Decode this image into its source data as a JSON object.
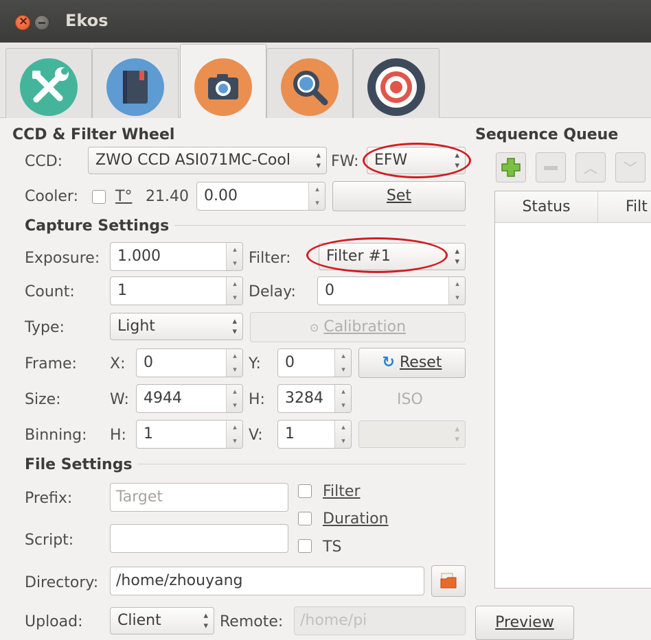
{
  "window": {
    "title": "Ekos"
  },
  "tabs": [
    {
      "name": "setup",
      "icon": "wrench-screwdriver-icon"
    },
    {
      "name": "scheduler",
      "icon": "notebook-icon"
    },
    {
      "name": "capture",
      "icon": "camera-icon",
      "active": true
    },
    {
      "name": "focus",
      "icon": "magnifier-icon"
    },
    {
      "name": "align",
      "icon": "target-icon"
    }
  ],
  "ccd_section": {
    "title": "CCD & Filter Wheel",
    "ccd_label": "CCD:",
    "ccd_value": "ZWO CCD ASI071MC-Cool",
    "fw_label": "FW:",
    "fw_value": "EFW",
    "cooler_label": "Cooler:",
    "temp_symbol": "T°",
    "temp_value": "21.40",
    "temp_setpoint": "0.00",
    "set_button": "Set"
  },
  "capture_section": {
    "title": "Capture Settings",
    "exposure_label": "Exposure:",
    "exposure_value": "1.000",
    "filter_label": "Filter:",
    "filter_value": "Filter #1",
    "count_label": "Count:",
    "count_value": "1",
    "delay_label": "Delay:",
    "delay_value": "0",
    "type_label": "Type:",
    "type_value": "Light",
    "calibration_button": "Calibration",
    "frame_label": "Frame:",
    "x_label": "X:",
    "x_value": "0",
    "y_label": "Y:",
    "y_value": "0",
    "reset_button": "Reset",
    "size_label": "Size:",
    "w_label": "W:",
    "w_value": "4944",
    "h_label": "H:",
    "h_value": "3284",
    "iso_label": "ISO",
    "binning_label": "Binning:",
    "bin_h_label": "H:",
    "bin_h_value": "1",
    "bin_v_label": "V:",
    "bin_v_value": "1",
    "iso_value": ""
  },
  "file_section": {
    "title": "File Settings",
    "prefix_label": "Prefix:",
    "prefix_placeholder": "Target",
    "filter_check": "Filter",
    "duration_check": "Duration",
    "ts_check": "TS",
    "script_label": "Script:",
    "script_value": "",
    "directory_label": "Directory:",
    "directory_value": "/home/zhouyang",
    "upload_label": "Upload:",
    "upload_value": "Client",
    "remote_label": "Remote:",
    "remote_value": "/home/pi"
  },
  "sequence": {
    "title": "Sequence Queue",
    "columns": [
      "Status",
      "Filt"
    ],
    "preview_button": "Preview"
  },
  "colors": {
    "annotation": "#d21d22",
    "add_icon": "#6bb22a"
  }
}
